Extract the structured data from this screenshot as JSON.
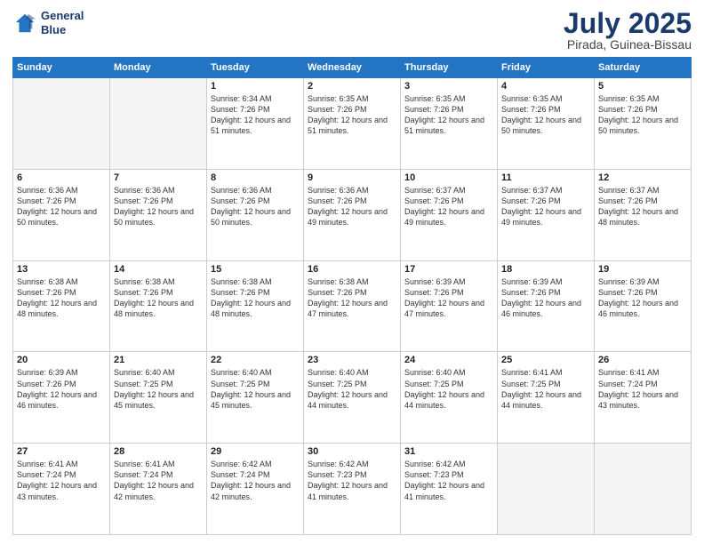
{
  "header": {
    "logo_line1": "General",
    "logo_line2": "Blue",
    "month": "July 2025",
    "location": "Pirada, Guinea-Bissau"
  },
  "weekdays": [
    "Sunday",
    "Monday",
    "Tuesday",
    "Wednesday",
    "Thursday",
    "Friday",
    "Saturday"
  ],
  "weeks": [
    [
      {
        "day": "",
        "text": ""
      },
      {
        "day": "",
        "text": ""
      },
      {
        "day": "1",
        "text": "Sunrise: 6:34 AM\nSunset: 7:26 PM\nDaylight: 12 hours and 51 minutes."
      },
      {
        "day": "2",
        "text": "Sunrise: 6:35 AM\nSunset: 7:26 PM\nDaylight: 12 hours and 51 minutes."
      },
      {
        "day": "3",
        "text": "Sunrise: 6:35 AM\nSunset: 7:26 PM\nDaylight: 12 hours and 51 minutes."
      },
      {
        "day": "4",
        "text": "Sunrise: 6:35 AM\nSunset: 7:26 PM\nDaylight: 12 hours and 50 minutes."
      },
      {
        "day": "5",
        "text": "Sunrise: 6:35 AM\nSunset: 7:26 PM\nDaylight: 12 hours and 50 minutes."
      }
    ],
    [
      {
        "day": "6",
        "text": "Sunrise: 6:36 AM\nSunset: 7:26 PM\nDaylight: 12 hours and 50 minutes."
      },
      {
        "day": "7",
        "text": "Sunrise: 6:36 AM\nSunset: 7:26 PM\nDaylight: 12 hours and 50 minutes."
      },
      {
        "day": "8",
        "text": "Sunrise: 6:36 AM\nSunset: 7:26 PM\nDaylight: 12 hours and 50 minutes."
      },
      {
        "day": "9",
        "text": "Sunrise: 6:36 AM\nSunset: 7:26 PM\nDaylight: 12 hours and 49 minutes."
      },
      {
        "day": "10",
        "text": "Sunrise: 6:37 AM\nSunset: 7:26 PM\nDaylight: 12 hours and 49 minutes."
      },
      {
        "day": "11",
        "text": "Sunrise: 6:37 AM\nSunset: 7:26 PM\nDaylight: 12 hours and 49 minutes."
      },
      {
        "day": "12",
        "text": "Sunrise: 6:37 AM\nSunset: 7:26 PM\nDaylight: 12 hours and 48 minutes."
      }
    ],
    [
      {
        "day": "13",
        "text": "Sunrise: 6:38 AM\nSunset: 7:26 PM\nDaylight: 12 hours and 48 minutes."
      },
      {
        "day": "14",
        "text": "Sunrise: 6:38 AM\nSunset: 7:26 PM\nDaylight: 12 hours and 48 minutes."
      },
      {
        "day": "15",
        "text": "Sunrise: 6:38 AM\nSunset: 7:26 PM\nDaylight: 12 hours and 48 minutes."
      },
      {
        "day": "16",
        "text": "Sunrise: 6:38 AM\nSunset: 7:26 PM\nDaylight: 12 hours and 47 minutes."
      },
      {
        "day": "17",
        "text": "Sunrise: 6:39 AM\nSunset: 7:26 PM\nDaylight: 12 hours and 47 minutes."
      },
      {
        "day": "18",
        "text": "Sunrise: 6:39 AM\nSunset: 7:26 PM\nDaylight: 12 hours and 46 minutes."
      },
      {
        "day": "19",
        "text": "Sunrise: 6:39 AM\nSunset: 7:26 PM\nDaylight: 12 hours and 46 minutes."
      }
    ],
    [
      {
        "day": "20",
        "text": "Sunrise: 6:39 AM\nSunset: 7:26 PM\nDaylight: 12 hours and 46 minutes."
      },
      {
        "day": "21",
        "text": "Sunrise: 6:40 AM\nSunset: 7:25 PM\nDaylight: 12 hours and 45 minutes."
      },
      {
        "day": "22",
        "text": "Sunrise: 6:40 AM\nSunset: 7:25 PM\nDaylight: 12 hours and 45 minutes."
      },
      {
        "day": "23",
        "text": "Sunrise: 6:40 AM\nSunset: 7:25 PM\nDaylight: 12 hours and 44 minutes."
      },
      {
        "day": "24",
        "text": "Sunrise: 6:40 AM\nSunset: 7:25 PM\nDaylight: 12 hours and 44 minutes."
      },
      {
        "day": "25",
        "text": "Sunrise: 6:41 AM\nSunset: 7:25 PM\nDaylight: 12 hours and 44 minutes."
      },
      {
        "day": "26",
        "text": "Sunrise: 6:41 AM\nSunset: 7:24 PM\nDaylight: 12 hours and 43 minutes."
      }
    ],
    [
      {
        "day": "27",
        "text": "Sunrise: 6:41 AM\nSunset: 7:24 PM\nDaylight: 12 hours and 43 minutes."
      },
      {
        "day": "28",
        "text": "Sunrise: 6:41 AM\nSunset: 7:24 PM\nDaylight: 12 hours and 42 minutes."
      },
      {
        "day": "29",
        "text": "Sunrise: 6:42 AM\nSunset: 7:24 PM\nDaylight: 12 hours and 42 minutes."
      },
      {
        "day": "30",
        "text": "Sunrise: 6:42 AM\nSunset: 7:23 PM\nDaylight: 12 hours and 41 minutes."
      },
      {
        "day": "31",
        "text": "Sunrise: 6:42 AM\nSunset: 7:23 PM\nDaylight: 12 hours and 41 minutes."
      },
      {
        "day": "",
        "text": ""
      },
      {
        "day": "",
        "text": ""
      }
    ]
  ]
}
